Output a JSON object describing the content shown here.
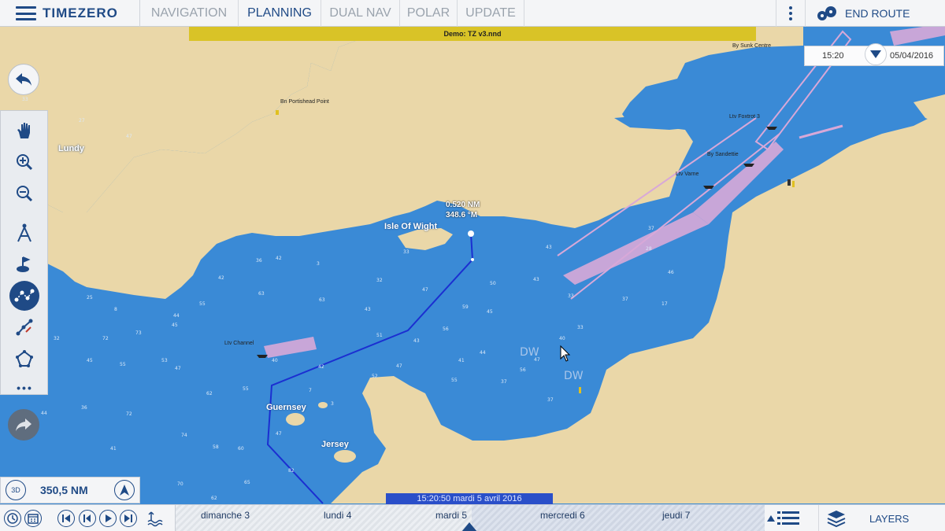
{
  "topbar": {
    "brand": "TIMEZERO",
    "tabs": [
      {
        "label": "NAVIGATION",
        "active": false
      },
      {
        "label": "PLANNING",
        "active": true
      },
      {
        "label": "DUAL NAV",
        "active": false
      },
      {
        "label": "POLAR",
        "active": false
      },
      {
        "label": "UPDATE",
        "active": false
      }
    ],
    "end_route_label": "END ROUTE"
  },
  "banner": {
    "text": "Demo: TZ v3.nnd"
  },
  "timebox": {
    "time": "15:20",
    "date": "05/04/2016"
  },
  "map": {
    "place_labels": [
      "Lundy",
      "Isle Of Wight",
      "Guernsey",
      "Jersey"
    ],
    "small_labels": [
      "Bn Portishead Point",
      "By Sunk Centre",
      "Ltv Foxtrot 3",
      "By Sandettie",
      "Ltv Varne",
      "Ltv Channel"
    ],
    "route_info": {
      "distance": "0.520 NM",
      "bearing": "348.6 °M"
    },
    "dw_labels": [
      "DW",
      "DW"
    ]
  },
  "distance_panel": {
    "mode": "3D",
    "value": "350,5 NM"
  },
  "time_label": "15:20:50 mardi 5 avril 2016",
  "timeline": {
    "days": [
      "dimanche 3",
      "lundi 4",
      "mardi 5",
      "mercredi 6",
      "jeudi 7"
    ]
  },
  "layers_label": "LAYERS",
  "colors": {
    "sea": "#3a8ad6",
    "land": "#ead7a8",
    "route": "#1b2fd1",
    "accent": "#1f4a86",
    "tss": "#d8a8d8"
  }
}
